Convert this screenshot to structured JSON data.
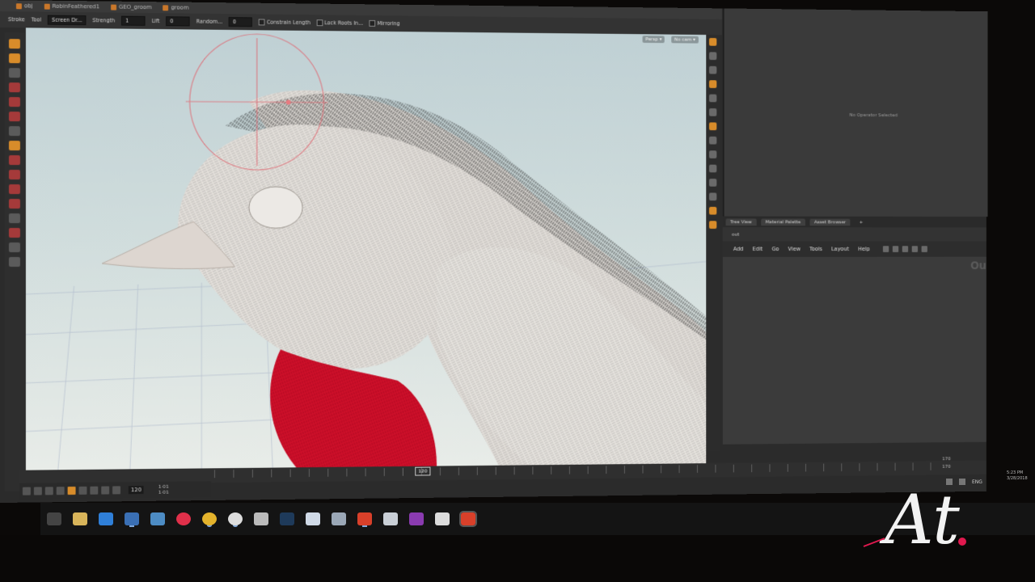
{
  "top_tabs": [
    {
      "label": "obj"
    },
    {
      "label": "RobinFeathered1"
    },
    {
      "label": "GEO_groom"
    },
    {
      "label": "groom"
    }
  ],
  "tool_options": {
    "mode_label": "Stroke",
    "mode2_label": "Tool",
    "screen_label": "Screen Dr...",
    "strength_label": "Strength",
    "strength_value": "1",
    "lift_label": "Lift",
    "lift_value": "0",
    "random_label": "Random...",
    "random_value": "0",
    "constrain_length": "Constrain Length",
    "lock_roots": "Lock Roots In...",
    "mirroring": "Mirroring"
  },
  "viewport": {
    "persp_label": "Persp ▾",
    "cam_label": "No cam ▾"
  },
  "right_panel": {
    "no_operator": "No Operator Selected",
    "tabs": [
      "Tree View",
      "Material Palette",
      "Asset Browser"
    ],
    "tab_add": "+",
    "path": "out",
    "menu": [
      "Add",
      "Edit",
      "Go",
      "View",
      "Tools",
      "Layout",
      "Help"
    ],
    "ghost_text": "Ou"
  },
  "timeline": {
    "current_frame": "120",
    "frame_field": "120",
    "start_frames": [
      "1·01",
      "1·01"
    ],
    "end_frames": [
      "170",
      "170"
    ],
    "tick_labels": [
      "120"
    ]
  },
  "taskbar": {
    "icons": [
      "windows-icon",
      "file-explorer-icon",
      "edge-icon",
      "mail-icon",
      "photos-icon",
      "app-red-icon",
      "chrome-icon",
      "obs-icon",
      "houdini-icon",
      "photoshop-icon",
      "notes-icon",
      "folder-icon",
      "houdini-red-icon",
      "tool-icon",
      "onenote-icon",
      "chat-icon",
      "houdini-active-icon"
    ]
  },
  "tray": {
    "lang": "ENG",
    "time": "5:23 PM",
    "date": "3/28/2018"
  },
  "watermark": {
    "text": "At"
  },
  "colors": {
    "accent_orange": "#d88c2a",
    "feather_red": "#d0102a",
    "viewport_sky": "#c6d5d8"
  }
}
